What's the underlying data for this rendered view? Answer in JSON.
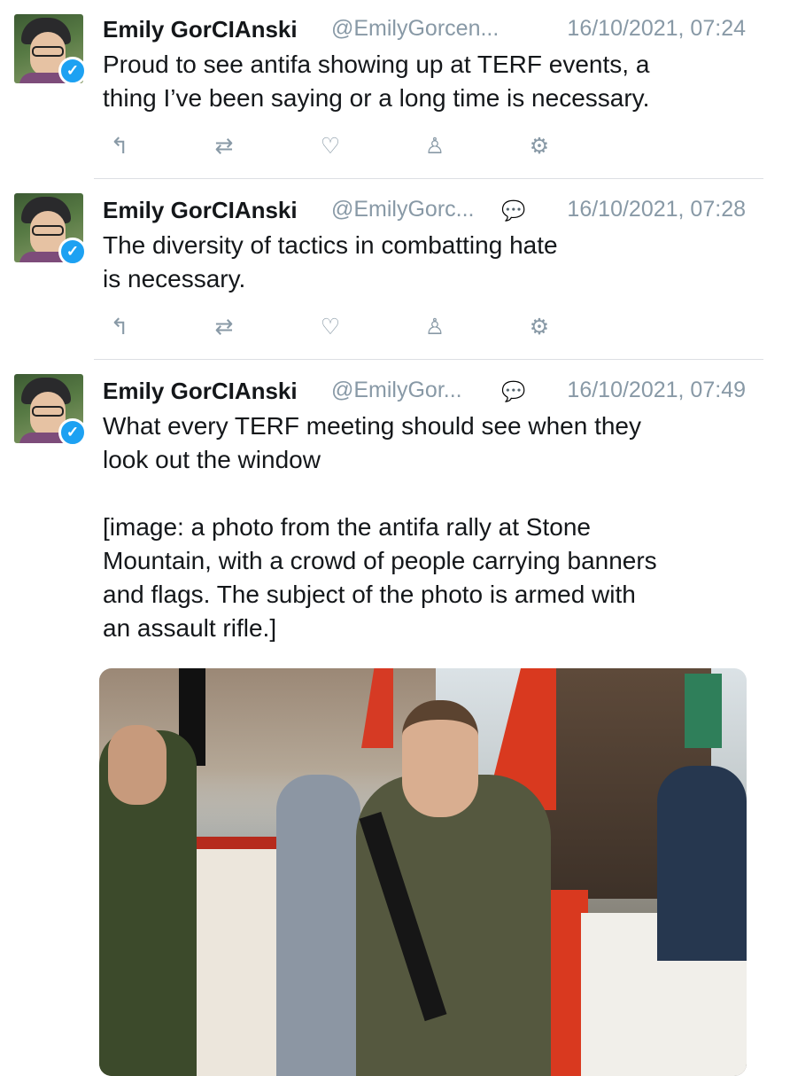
{
  "tweets": [
    {
      "name": "Emily GorCIAnski",
      "handle": "@EmilyGorcen...",
      "timestamp": "16/10/2021, 07:24",
      "text": "Proud to see antifa showing up at TERF events, a\nthing I’ve been saying or a long time is necessary."
    },
    {
      "name": "Emily GorCIAnski",
      "handle": "@EmilyGorc...",
      "timestamp": "16/10/2021, 07:28",
      "text": "The diversity of tactics in combatting hate\nis necessary."
    },
    {
      "name": "Emily GorCIAnski",
      "handle": "@EmilyGor...",
      "timestamp": "16/10/2021, 07:49",
      "text": "What every TERF meeting should see when they\nlook out the window\n\n[image: a photo from the antifa rally at Stone\nMountain, with a crowd of people carrying banners\nand flags. The subject of the photo is armed with\nan assault rifle.]"
    }
  ],
  "icons": {
    "reply": "reply-icon",
    "retweet": "retweet-icon",
    "like": "heart-icon",
    "profile": "profile-icon",
    "settings": "gear-icon",
    "conversation": "conversation-icon",
    "verified": "verified-badge-icon"
  },
  "colors": {
    "accent": "#1da1f2",
    "muted": "#8899a6",
    "text": "#14171a",
    "divider": "#dcdfe3"
  }
}
